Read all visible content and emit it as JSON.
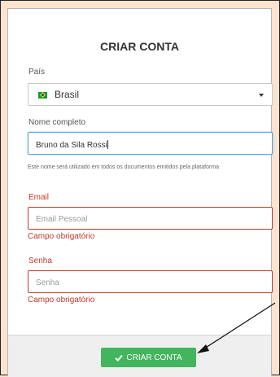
{
  "form": {
    "title": "CRIAR CONTA",
    "country": {
      "label": "País",
      "selected": "Brasil",
      "flag_icon": "brazil-flag-icon"
    },
    "full_name": {
      "label": "Nome completo",
      "value": "Bruno da Sila Rossi",
      "help": "Este nome será utilizado em todos os documentos emitidos pela plataforma"
    },
    "email": {
      "label": "Email",
      "placeholder": "Email Pessoal",
      "error": "Campo obrigatório"
    },
    "password": {
      "label": "Senha",
      "placeholder": "Senha",
      "error": "Campo obrigatório"
    },
    "submit": {
      "label": "CRIAR CONTA",
      "icon": "check-icon"
    }
  },
  "colors": {
    "page_background": "#fbe3cf",
    "error": "#c0392b",
    "focus": "#5aa1e3",
    "button": "#43b55e"
  }
}
